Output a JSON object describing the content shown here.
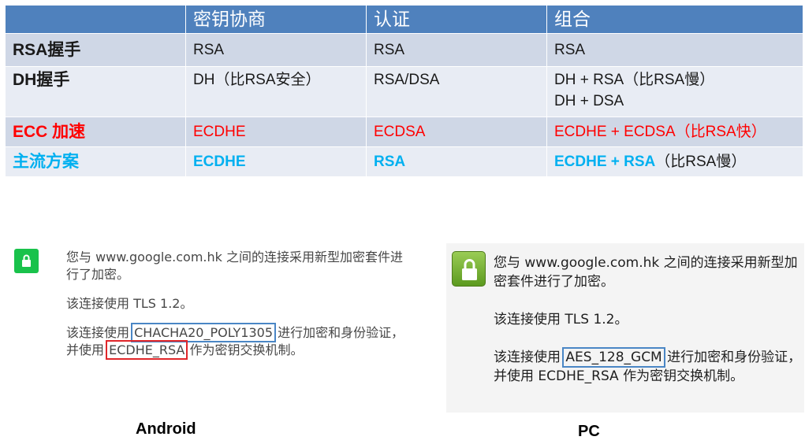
{
  "table": {
    "headers": [
      "",
      "密钥协商",
      "认证",
      "组合"
    ],
    "rows": [
      {
        "label": "RSA握手",
        "key_exchange": "RSA",
        "auth": "RSA",
        "combo": [
          "RSA"
        ]
      },
      {
        "label": "DH握手",
        "key_exchange": "DH（比RSA安全）",
        "auth": "RSA/DSA",
        "combo": [
          "DH + RSA（比RSA慢）",
          "DH + DSA"
        ]
      },
      {
        "label": "ECC 加速",
        "key_exchange": "ECDHE",
        "auth": "ECDSA",
        "combo": [
          "ECDHE + ECDSA（比RSA快）"
        ]
      },
      {
        "label": "主流方案",
        "key_exchange": "ECDHE",
        "auth": "RSA",
        "combo_main": "ECDHE + RSA",
        "combo_note": "（比RSA慢）"
      }
    ],
    "colors": {
      "header_bg": "#4f81bd",
      "row_dark": "#cfd7e6",
      "row_light": "#e8ecf4",
      "highlight_red": "#ff0000",
      "highlight_blue": "#00b0f0"
    }
  },
  "android": {
    "icon": "lock-icon",
    "para1": "您与 www.google.com.hk 之间的连接采用新型加密套件进行了加密。",
    "para2": "该连接使用 TLS 1.2。",
    "para3_a": "该连接使用 ",
    "cipher": "CHACHA20_POLY1305",
    "para3_b": " 进行加密和身份验证，并使用 ",
    "key_exchange": "ECDHE_RSA",
    "para3_c": " 作为密钥交换机制。",
    "caption": "Android",
    "box_colors": {
      "cipher": "#4a86c5",
      "key_exchange": "#e0262a"
    }
  },
  "pc": {
    "icon": "lock-icon",
    "para1": "您与 www.google.com.hk 之间的连接采用新型加密套件进行了加密。",
    "para2": "该连接使用 TLS 1.2。",
    "para3_a": "该连接使用 ",
    "cipher": "AES_128_GCM",
    "para3_b": " 进行加密和身份验证，并使用 ECDHE_RSA 作为密钥交换机制。",
    "caption": "PC",
    "box_colors": {
      "cipher": "#4a86c5"
    }
  }
}
